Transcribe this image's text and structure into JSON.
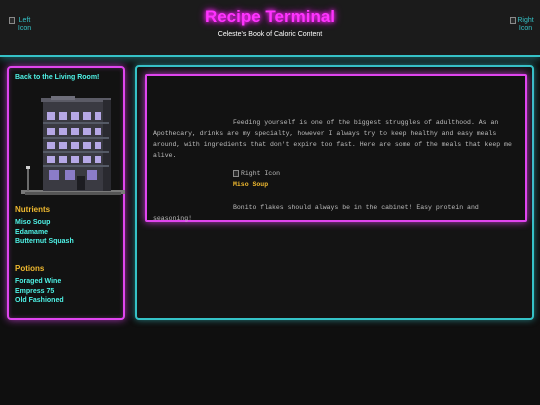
{
  "header": {
    "title": "Recipe Terminal",
    "subtitle": "Celeste's Book of Caloric Content",
    "left_icon_alt": "Left Icon",
    "right_icon_alt": "Right Icon"
  },
  "sidebar": {
    "back_link": "Back to the Living Room!",
    "building_image": "pixel-apartment-building",
    "nutrients_heading": "Nutrients",
    "nutrients": [
      "Miso Soup",
      "Edamame",
      "Butternut Squash"
    ],
    "potions_heading": "Potions",
    "potions": [
      "Foraged Wine",
      "Empress 75",
      "Old Fashioned"
    ]
  },
  "main": {
    "intro": "Feeding yourself is one of the biggest struggles of adulthood. As an Apothecary, drinks are my specialty, however I always try to keep healthy and easy meals around, with ingredients that don't expire too fast. Here are some of the meals that keep me alive.",
    "image_alt": "Right Icon",
    "recipe_title": "Miso Soup",
    "recipe_text": "Bonito flakes should always be in the cabinet! Easy protein and seasoning!"
  },
  "colors": {
    "magenta_neon": "#e045ef",
    "cyan_neon": "#35c2c7",
    "link_cyan": "#4ff3e7",
    "gold": "#f0b92f",
    "title_pink": "#ff33ff"
  }
}
